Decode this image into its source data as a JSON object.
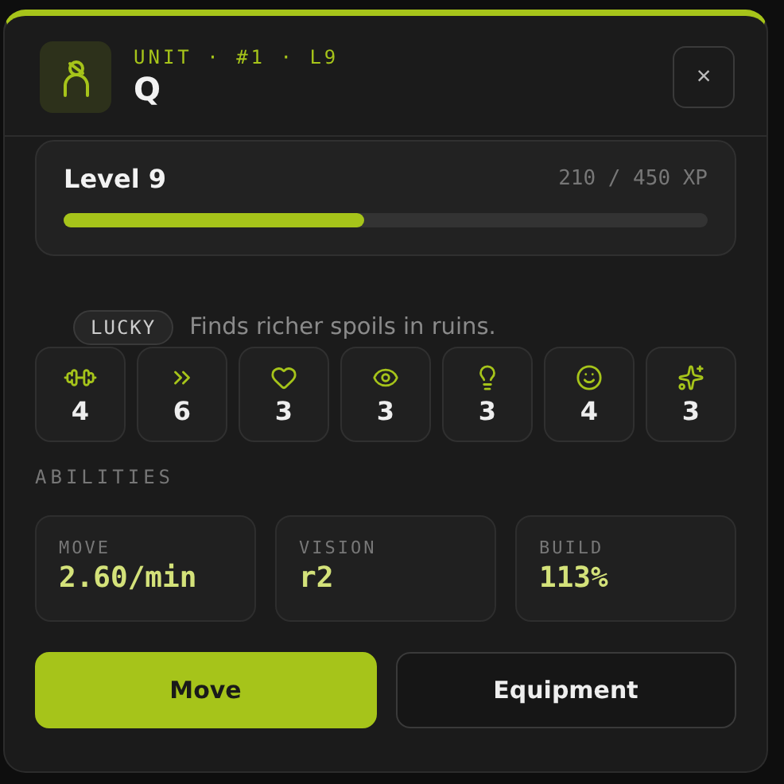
{
  "header": {
    "subtitle": "UNIT · #1 · L9",
    "title": "Q",
    "close": "×"
  },
  "level": {
    "label": "Level 9",
    "reading": "210 / 450 XP",
    "level": 0.467
  },
  "trait": {
    "badge": "LUCKY",
    "description": "Finds richer spoils in ruins."
  },
  "stats": [
    {
      "kind": "strength",
      "value": "4"
    },
    {
      "kind": "speed",
      "value": "6"
    },
    {
      "kind": "health",
      "value": "3"
    },
    {
      "kind": "sight",
      "value": "3"
    },
    {
      "kind": "intellect",
      "value": "3"
    },
    {
      "kind": "charm",
      "value": "4"
    },
    {
      "kind": "luck",
      "value": "3"
    }
  ],
  "abilities_heading": "ABILITIES",
  "abilities": [
    {
      "label": "MOVE",
      "value": "2.60/min"
    },
    {
      "label": "VISION",
      "value": "r2"
    },
    {
      "label": "BUILD",
      "value": "113%"
    }
  ],
  "buttons": [
    {
      "label": "Move",
      "primary": true
    },
    {
      "label": "Equipment",
      "primary": false
    }
  ]
}
